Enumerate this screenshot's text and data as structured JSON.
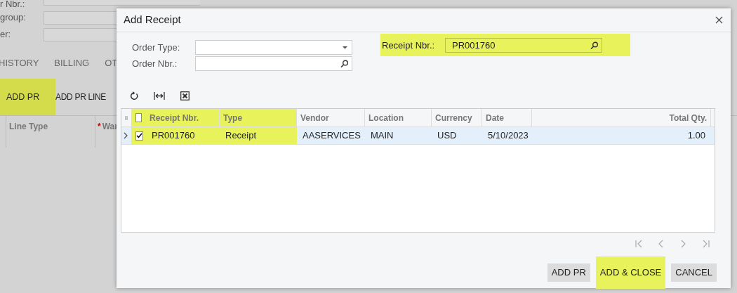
{
  "background": {
    "fields": [
      {
        "label": "r Nbr.:"
      },
      {
        "label": "group:"
      },
      {
        "label": "er:"
      }
    ],
    "tabs": [
      {
        "label": "HISTORY"
      },
      {
        "label": "BILLING"
      },
      {
        "label": "OT"
      }
    ],
    "toolbar": [
      {
        "label": "ADD PR",
        "highlighted": true
      },
      {
        "label": "ADD PR LINE",
        "highlighted": false
      }
    ],
    "grid_columns": [
      {
        "label": "Line Type"
      },
      {
        "label": "War",
        "required_mark": "*"
      }
    ]
  },
  "dialog": {
    "title": "Add Receipt",
    "filters": [
      {
        "label": "Order Type:",
        "kind": "dropdown",
        "highlighted": false
      },
      {
        "label": "Order Nbr.:",
        "kind": "search",
        "highlighted": false
      },
      {
        "label": "Receipt Nbr.:",
        "kind": "search",
        "value": "PR001760",
        "highlighted": true
      }
    ],
    "grid": {
      "header_checked": false,
      "columns": [
        {
          "label": "Receipt Nbr.",
          "highlighted": true
        },
        {
          "label": "Type",
          "highlighted": true
        },
        {
          "label": "Vendor",
          "highlighted": false
        },
        {
          "label": "Location",
          "highlighted": false
        },
        {
          "label": "Currency",
          "highlighted": false
        },
        {
          "label": "Date",
          "highlighted": false
        },
        {
          "label": "Total Qty.",
          "highlighted": false
        }
      ],
      "rows": [
        {
          "checked": true,
          "selected": true,
          "cells": [
            "PR001760",
            "Receipt",
            "AASERVICES",
            "MAIN",
            "USD",
            "5/10/2023",
            "1.00"
          ]
        }
      ]
    },
    "buttons": [
      {
        "label": "ADD PR",
        "highlighted": false
      },
      {
        "label": "ADD & CLOSE",
        "highlighted": true
      },
      {
        "label": "CANCEL",
        "highlighted": false
      }
    ]
  }
}
